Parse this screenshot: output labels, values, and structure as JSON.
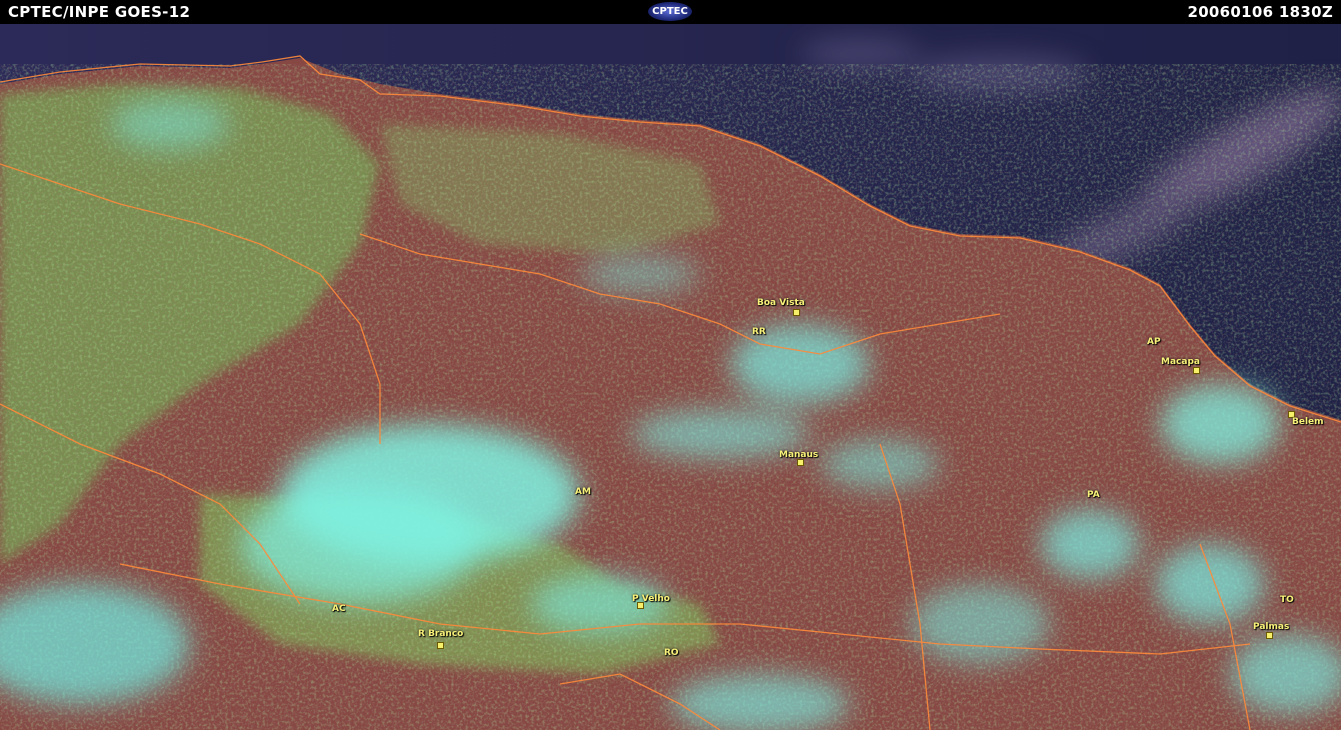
{
  "header": {
    "left_title": "CPTEC/INPE  GOES-12",
    "logo_text": "CPTEC",
    "timestamp": "20060106  1830Z"
  },
  "map": {
    "places": [
      {
        "key": "boa-vista",
        "label": "Boa Vista",
        "type": "city"
      },
      {
        "key": "rr",
        "label": "RR",
        "type": "state"
      },
      {
        "key": "ap",
        "label": "AP",
        "type": "state"
      },
      {
        "key": "macapa",
        "label": "Macapa",
        "type": "city"
      },
      {
        "key": "belem",
        "label": "Belem",
        "type": "city"
      },
      {
        "key": "manaus",
        "label": "Manaus",
        "type": "city"
      },
      {
        "key": "am",
        "label": "AM",
        "type": "state"
      },
      {
        "key": "pa",
        "label": "PA",
        "type": "state"
      },
      {
        "key": "ac",
        "label": "AC",
        "type": "state"
      },
      {
        "key": "p-velho",
        "label": "P Velho",
        "type": "city"
      },
      {
        "key": "r-branco",
        "label": "R Branco",
        "type": "city"
      },
      {
        "key": "ro",
        "label": "RO",
        "type": "state"
      },
      {
        "key": "to",
        "label": "TO",
        "type": "state"
      },
      {
        "key": "palmas",
        "label": "Palmas",
        "type": "city"
      }
    ],
    "colors": {
      "ocean": "#2a2850",
      "land": "#8a4a46",
      "cloud_cyan": "#6ff0e6",
      "vegetation_green": "#7fe06a",
      "borders": "#ff8a3a",
      "labels": "#f9f27a"
    }
  }
}
